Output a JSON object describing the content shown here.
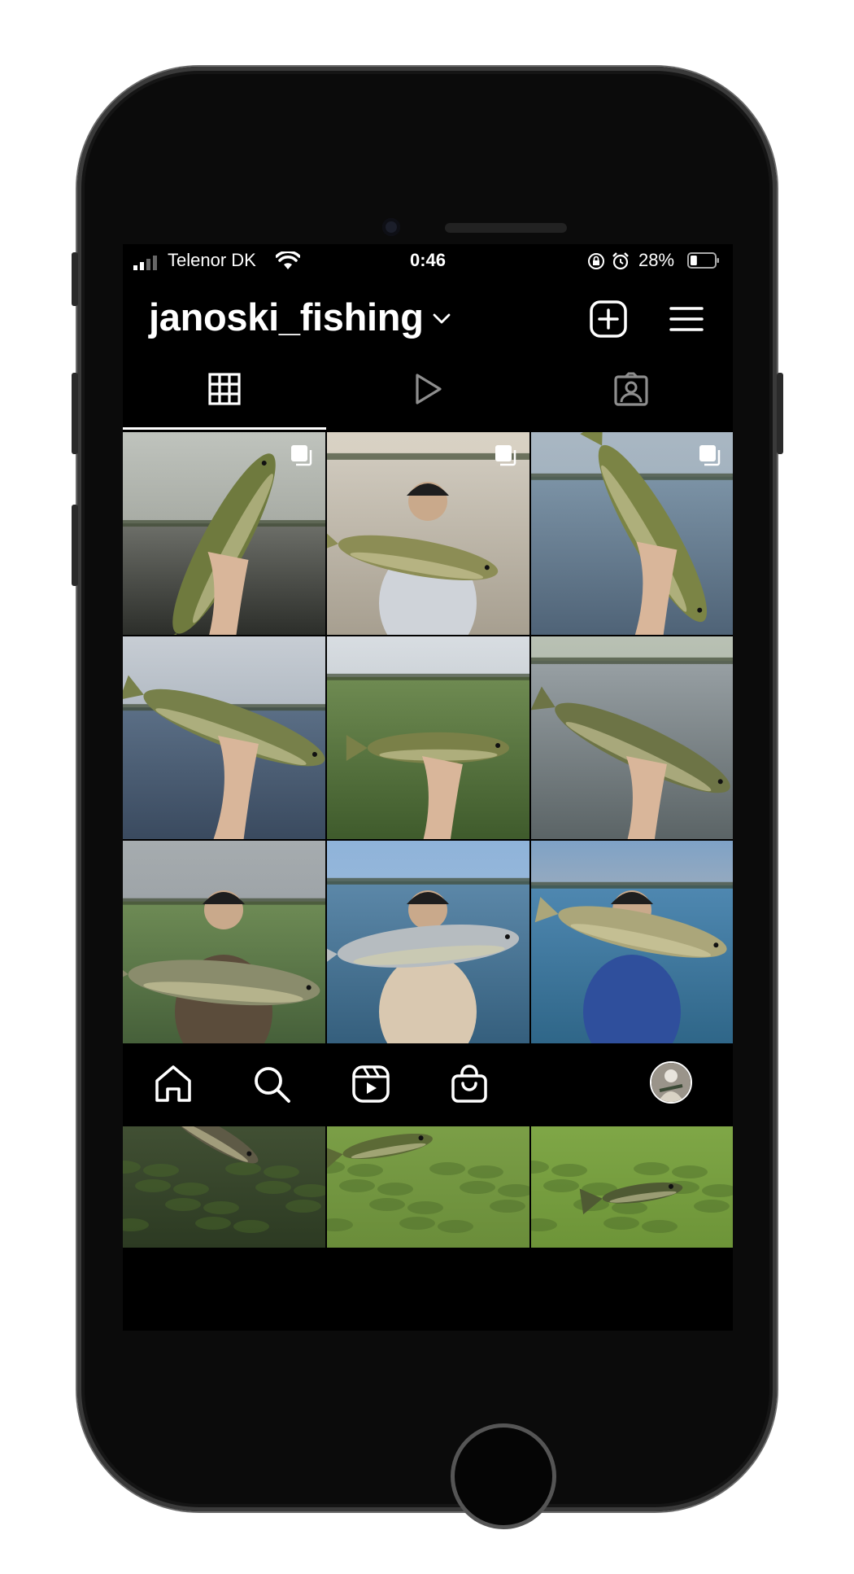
{
  "status_bar": {
    "carrier": "Telenor DK",
    "time": "0:46",
    "battery_percent": "28%",
    "battery_level": 0.28
  },
  "profile": {
    "username": "janoski_fishing"
  },
  "tabs": [
    {
      "name": "grid",
      "icon": "grid-icon",
      "active": true
    },
    {
      "name": "reels",
      "icon": "play-icon",
      "active": false
    },
    {
      "name": "tagged",
      "icon": "tagged-person-icon",
      "active": false
    }
  ],
  "posts": [
    {
      "type": "carousel",
      "scene": "pike-held-sunset"
    },
    {
      "type": "carousel",
      "scene": "beanie-angler-pike"
    },
    {
      "type": "carousel",
      "scene": "pike-reeds-blue-sleeve"
    },
    {
      "type": "photo",
      "scene": "pike-hand-lake"
    },
    {
      "type": "photo",
      "scene": "perch-lure-grass"
    },
    {
      "type": "photo",
      "scene": "pike-hand-reeds"
    },
    {
      "type": "photo",
      "scene": "zander-hoodie-angler"
    },
    {
      "type": "photo",
      "scene": "chub-boat-angler"
    },
    {
      "type": "photo",
      "scene": "pike-pier-angler"
    },
    {
      "type": "video",
      "scene": "underwater-catfish"
    },
    {
      "type": "video",
      "scene": "underwater-green-fish"
    },
    {
      "type": "video",
      "scene": "underwater-lure-fish"
    }
  ],
  "bottom_nav": [
    {
      "name": "home",
      "icon": "home-icon"
    },
    {
      "name": "search",
      "icon": "search-icon"
    },
    {
      "name": "reels",
      "icon": "reels-icon"
    },
    {
      "name": "shop",
      "icon": "shop-bag-icon"
    },
    {
      "name": "profile",
      "icon": "profile-avatar"
    }
  ],
  "colors": {
    "background": "#000000",
    "foreground": "#ffffff"
  }
}
